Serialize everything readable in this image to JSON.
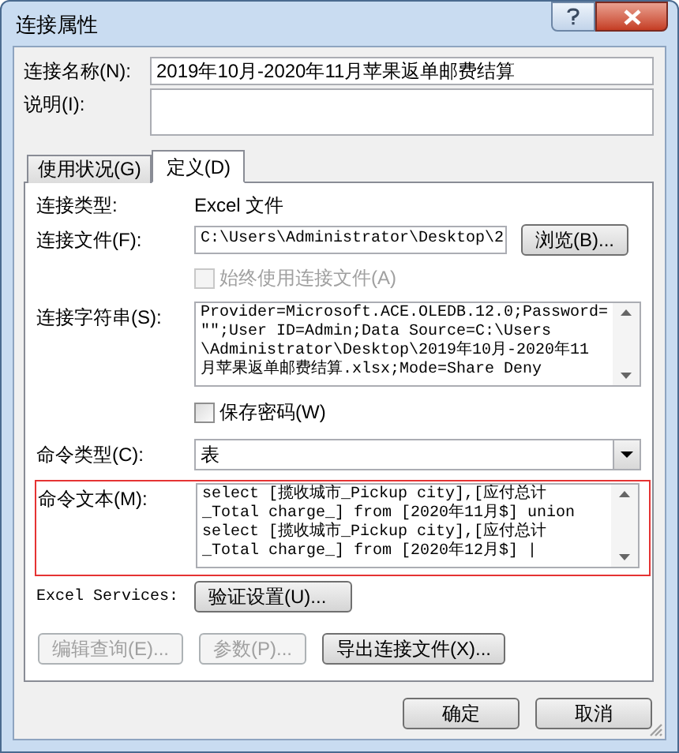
{
  "window": {
    "title": "连接属性"
  },
  "connection_name": {
    "label": "连接名称(N):",
    "value": "2019年10月-2020年11月苹果返单邮费结算"
  },
  "description": {
    "label": "说明(I):"
  },
  "tabs": [
    {
      "label": "使用状况(G)",
      "selected": false
    },
    {
      "label": "定义(D)",
      "selected": true
    }
  ],
  "definition": {
    "connection_type": {
      "label": "连接类型:",
      "value": "Excel 文件"
    },
    "connection_file": {
      "label": "连接文件(F):",
      "value": "C:\\Users\\Administrator\\Desktop\\2",
      "button": "浏览(B)..."
    },
    "always_use_file": {
      "label": "始终使用连接文件(A)",
      "checked": false,
      "disabled": true
    },
    "connection_string": {
      "label": "连接字符串(S):",
      "lines": [
        "Provider=Microsoft.ACE.OLEDB.12.0;Password=",
        "\"\";User ID=Admin;Data Source=C:\\Users",
        "\\Administrator\\Desktop\\2019年10月-2020年11",
        "月苹果返单邮费结算.xlsx;Mode=Share Deny"
      ]
    },
    "save_password": {
      "label": "保存密码(W)",
      "checked": false,
      "disabled": false
    },
    "command_type": {
      "label": "命令类型(C):",
      "value": "表"
    },
    "command_text": {
      "label": "命令文本(M):",
      "highlighted": true,
      "lines": [
        "select [揽收城市_Pickup city],[应付总计",
        "_Total charge_] from [2020年11月$] union",
        "select [揽收城市_Pickup city],[应付总计",
        "_Total charge_] from [2020年12月$] |"
      ]
    },
    "excel_services": {
      "label": "Excel Services:",
      "button": "验证设置(U)..."
    },
    "buttons": [
      {
        "label": "编辑查询(E)...",
        "disabled": true
      },
      {
        "label": "参数(P)...",
        "disabled": true
      },
      {
        "label": "导出连接文件(X)...",
        "disabled": false
      }
    ]
  },
  "footer_buttons": [
    "确定",
    "取消"
  ]
}
